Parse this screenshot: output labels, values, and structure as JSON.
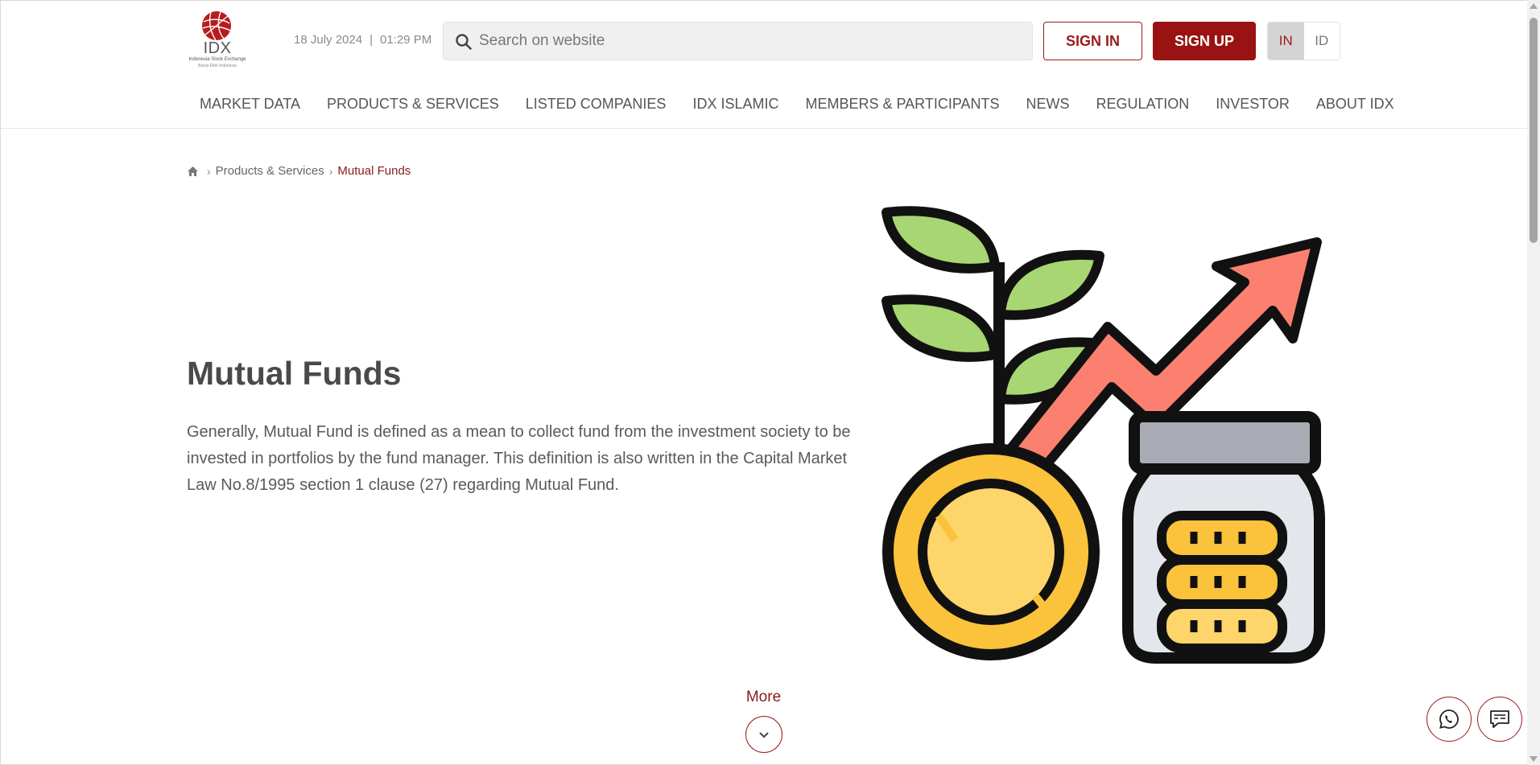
{
  "header": {
    "logo": {
      "name": "IDX",
      "line1": "Indonesia Stock Exchange",
      "line2": "Bursa Efek Indonesia"
    },
    "date": "18 July 2024",
    "separator": "|",
    "time": "01:29 PM",
    "search_placeholder": "Search on website",
    "signin_label": "SIGN IN",
    "signup_label": "SIGN UP",
    "lang_in": "IN",
    "lang_id": "ID"
  },
  "nav": {
    "items": [
      {
        "label": "MARKET DATA"
      },
      {
        "label": "PRODUCTS & SERVICES"
      },
      {
        "label": "LISTED COMPANIES"
      },
      {
        "label": "IDX ISLAMIC"
      },
      {
        "label": "MEMBERS & PARTICIPANTS"
      },
      {
        "label": "NEWS"
      },
      {
        "label": "REGULATION"
      },
      {
        "label": "INVESTOR"
      },
      {
        "label": "ABOUT IDX"
      }
    ]
  },
  "breadcrumb": {
    "home_icon": "home-icon",
    "items": [
      "Products & Services",
      "Mutual Funds"
    ]
  },
  "main": {
    "title": "Mutual Funds",
    "description": "Generally, Mutual Fund is defined as a mean to collect fund from the investment society to be invested in portfolios by the fund manager. This definition is also written in the Capital Market Law No.8/1995 section 1 clause (27) regarding Mutual Fund.",
    "illustration": "growth-coins-illustration",
    "more_label": "More"
  },
  "floating": {
    "whatsapp_icon": "whatsapp-icon",
    "chat_icon": "chat-icon"
  },
  "colors": {
    "brand": "#9a1313",
    "leaf": "#a8d672",
    "arrow": "#fb8070",
    "coin": "#fbc23c",
    "coin_inner": "#fdd56a",
    "jar_lid": "#a8abb4",
    "jar_body": "#e3e6ea"
  }
}
